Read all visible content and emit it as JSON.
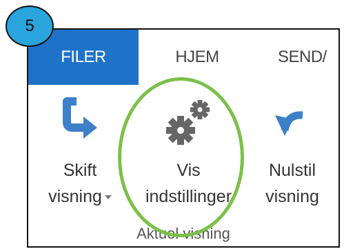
{
  "badge": {
    "number": "5",
    "color": "#2aa4dc"
  },
  "tabs": [
    {
      "label": "FILER",
      "active": true
    },
    {
      "label": "HJEM",
      "active": false
    },
    {
      "label": "SEND/",
      "active": false
    }
  ],
  "ribbon": {
    "buttons": [
      {
        "icon": "swap-arrow-icon",
        "line1": "Skift",
        "line2": "visning",
        "has_dropdown": true
      },
      {
        "icon": "gears-icon",
        "line1": "Vis",
        "line2": "indstillinger",
        "has_dropdown": false
      },
      {
        "icon": "undo-arrow-icon",
        "line1": "Nulstil",
        "line2": "visning",
        "has_dropdown": false
      }
    ],
    "group_label": "Aktuel visning"
  },
  "colors": {
    "active_tab": "#1e73c8",
    "icon_blue": "#3d7fc8",
    "icon_gray": "#666666",
    "highlight": "#7cc04a"
  }
}
